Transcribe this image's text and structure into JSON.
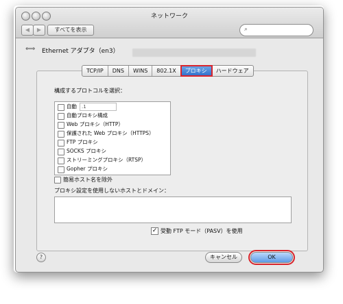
{
  "window": {
    "title": "ネットワーク"
  },
  "toolbar": {
    "back": "◀",
    "forward": "▶",
    "show_all": "すべてを表示",
    "search_placeholder": ""
  },
  "adapter": {
    "title": "Ethernet アダプタ（en3）"
  },
  "tabs": [
    {
      "label": "TCP/IP",
      "selected": false
    },
    {
      "label": "DNS",
      "selected": false
    },
    {
      "label": "WINS",
      "selected": false
    },
    {
      "label": "802.1X",
      "selected": false
    },
    {
      "label": "プロキシ",
      "selected": true
    },
    {
      "label": "ハードウェア",
      "selected": false
    }
  ],
  "proxy": {
    "select_label": "構成するプロトコルを選択：",
    "protocols": [
      {
        "label": "自動",
        "checked": false,
        "field_value": ".1"
      },
      {
        "label": "自動プロキシ構成",
        "checked": false
      },
      {
        "label": "Web プロキシ（HTTP）",
        "checked": false
      },
      {
        "label": "保護された Web プロキシ（HTTPS）",
        "checked": false
      },
      {
        "label": "FTP プロキシ",
        "checked": false
      },
      {
        "label": "SOCKS プロキシ",
        "checked": false
      },
      {
        "label": "ストリーミングプロキシ（RTSP）",
        "checked": false
      },
      {
        "label": "Gopher プロキシ",
        "checked": false
      }
    ],
    "exclude_simple_hosts": {
      "label": "簡易ホスト名を除外",
      "checked": false
    },
    "bypass_label": "プロキシ設定を使用しないホストとドメイン：",
    "bypass_value": "",
    "passive_ftp": {
      "label": "受動 FTP モード（PASV）を使用",
      "checked": true
    }
  },
  "buttons": {
    "help": "?",
    "cancel": "キャンセル",
    "ok": "OK"
  },
  "colors": {
    "highlight": "#d9242b",
    "selected_tab": "#2f6fcb"
  }
}
